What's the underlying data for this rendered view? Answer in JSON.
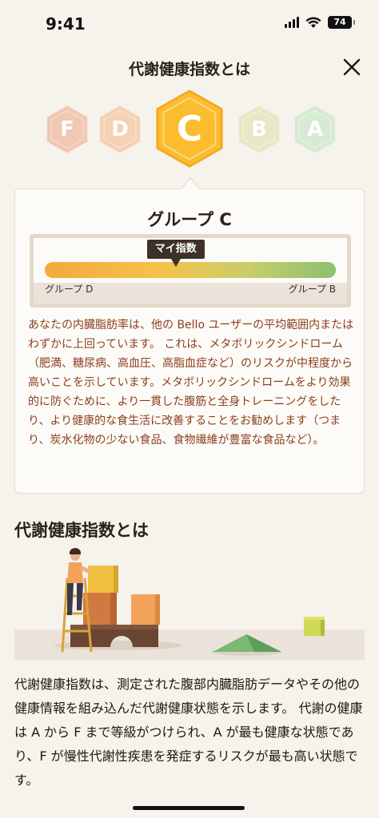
{
  "status_bar": {
    "time": "9:41",
    "battery": "74"
  },
  "header": {
    "title": "代謝健康指数とは",
    "close_icon": "close-icon"
  },
  "grades": [
    {
      "letter": "F",
      "color": "#f0c8b4",
      "selected": false
    },
    {
      "letter": "D",
      "color": "#f5d1b5",
      "selected": false
    },
    {
      "letter": "C",
      "color": "#fbbd2e",
      "selected": true
    },
    {
      "letter": "B",
      "color": "#e6e8c6",
      "selected": false
    },
    {
      "letter": "A",
      "color": "#d7ead3",
      "selected": false
    }
  ],
  "card": {
    "title": "グループ C",
    "meter": {
      "label": "マイ指数",
      "left_label": "グループ D",
      "right_label": "グループ B",
      "marker_position": 0.45
    },
    "description": "あなたの内臓脂肪率は、他の Bello ユーザーの平均範囲内またはわずかに上回っています。 これは、メタボリックシンドローム（肥満、糖尿病、高血圧、高脂血症など）のリスクが中程度から高いことを示しています。メタボリックシンドロームをより効果的に防ぐために、より一貫した腹筋と全身トレーニングをしたり、より健康的な食生活に改善することをお勧めします（つまり、炭水化物の少ない食品、食物繊維が豊富な食品など）。"
  },
  "section": {
    "title": "代謝健康指数とは",
    "body": "代謝健康指数は、測定された腹部内臓脂肪データやその他の健康情報を組み込んだ代謝健康状態を示します。 代謝の健康は A から F まで等級がつけられ、A が最も健康な状態であり、F が慢性代謝性疾患を発症するリスクが最も高い状態です。"
  },
  "colors": {
    "accent": "#fbbd2e",
    "text_accent": "#8a3e1e",
    "background": "#f6f2ec"
  }
}
